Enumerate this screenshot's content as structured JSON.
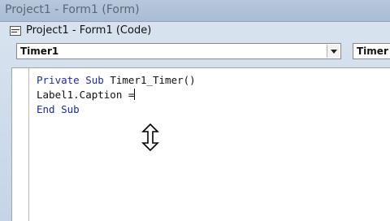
{
  "background_window": {
    "title": "Project1 - Form1 (Form)"
  },
  "code_window": {
    "title": "Project1 - Form1 (Code)",
    "object_combo": "Timer1",
    "procedure_combo": "Timer"
  },
  "code": {
    "line1_keyword1": "Private",
    "line1_keyword2": "Sub",
    "line1_name": " Timer1_Timer()",
    "line2": "Label1.Caption =",
    "line3_keyword1": "End",
    "line3_keyword2": "Sub"
  },
  "icons": {
    "cursor": "resize-vertical-cursor-icon",
    "app": "code-window-icon"
  },
  "colors": {
    "keyword": "#1a2ba6",
    "background": "#c9d6e6"
  }
}
